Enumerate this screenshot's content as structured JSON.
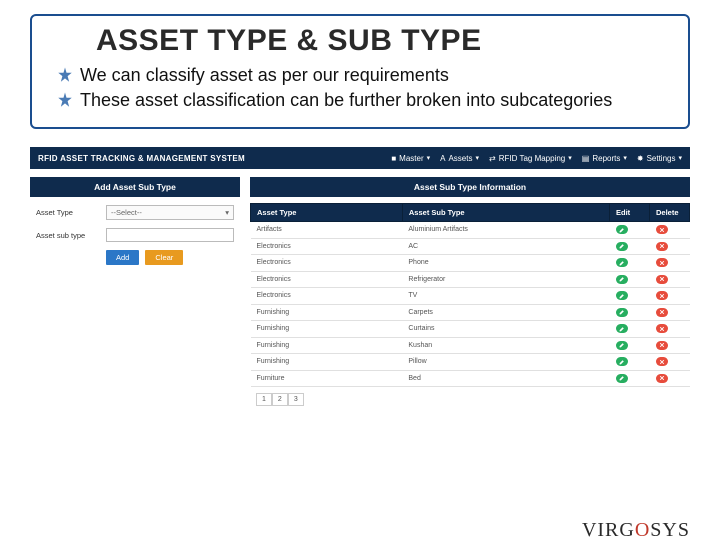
{
  "title": "ASSET TYPE & SUB TYPE",
  "bullets": [
    "We can classify  asset as per our  requirements",
    "These  asset classification  can be further broken into subcategories"
  ],
  "topnav": {
    "brand": "RFID ASSET TRACKING & MANAGEMENT SYSTEM",
    "items": [
      "Master",
      "Assets",
      "RFID Tag Mapping",
      "Reports",
      "Settings"
    ]
  },
  "leftPanel": {
    "header": "Add Asset Sub Type",
    "labels": {
      "type": "Asset Type",
      "subtype": "Asset sub type"
    },
    "selectPlaceholder": "--Select--",
    "buttons": {
      "add": "Add",
      "clear": "Clear"
    }
  },
  "rightPanel": {
    "header": "Asset Sub Type Information",
    "columns": [
      "Asset Type",
      "Asset Sub Type",
      "Edit",
      "Delete"
    ],
    "rows": [
      {
        "type": "Artifacts",
        "sub": "Aluminium Artifacts"
      },
      {
        "type": "Electronics",
        "sub": "AC"
      },
      {
        "type": "Electronics",
        "sub": "Phone"
      },
      {
        "type": "Electronics",
        "sub": "Refrigerator"
      },
      {
        "type": "Electronics",
        "sub": "TV"
      },
      {
        "type": "Furnishing",
        "sub": "Carpets"
      },
      {
        "type": "Furnishing",
        "sub": "Curtains"
      },
      {
        "type": "Furnishing",
        "sub": "Kushan"
      },
      {
        "type": "Furnishing",
        "sub": "Pillow"
      },
      {
        "type": "Furniture",
        "sub": "Bed"
      }
    ],
    "pager": [
      "1",
      "2",
      "3"
    ]
  },
  "logo": {
    "p1": "VIRG",
    "p2": "O",
    "p3": "SYS"
  }
}
